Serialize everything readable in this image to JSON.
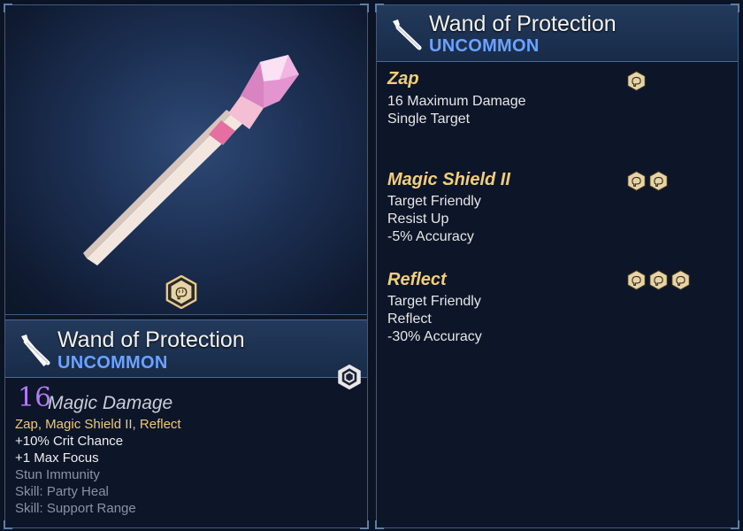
{
  "item": {
    "name": "Wand of Protection",
    "rarity": "UNCOMMON",
    "damage_value": "16",
    "damage_type": "Magic Damage",
    "skills_summary": "Zap, Magic Shield II, Reflect",
    "bonuses": [
      "+10% Crit Chance",
      "+1 Max Focus"
    ],
    "inactive_bonuses": [
      "Stun Immunity",
      "Skill: Party Heal",
      "Skill: Support Range"
    ]
  },
  "skills": [
    {
      "name": "Zap",
      "lines": [
        "16 Maximum Damage",
        "Single Target"
      ],
      "focus_cost": 1
    },
    {
      "name": "Magic Shield II",
      "lines": [
        "Target Friendly",
        "Resist Up",
        "-5% Accuracy"
      ],
      "focus_cost": 2
    },
    {
      "name": "Reflect",
      "lines": [
        "Target Friendly",
        "Reflect",
        "-30% Accuracy"
      ],
      "focus_cost": 3
    }
  ],
  "icons": {
    "wand": "wand-icon",
    "focus": "brain-focus-icon",
    "slot": "hex-slot-icon"
  },
  "colors": {
    "rarity": "#6ba2ff",
    "skill_name": "#f3cd7a",
    "damage_value": "#b07cf0",
    "background": "#0c1628"
  }
}
